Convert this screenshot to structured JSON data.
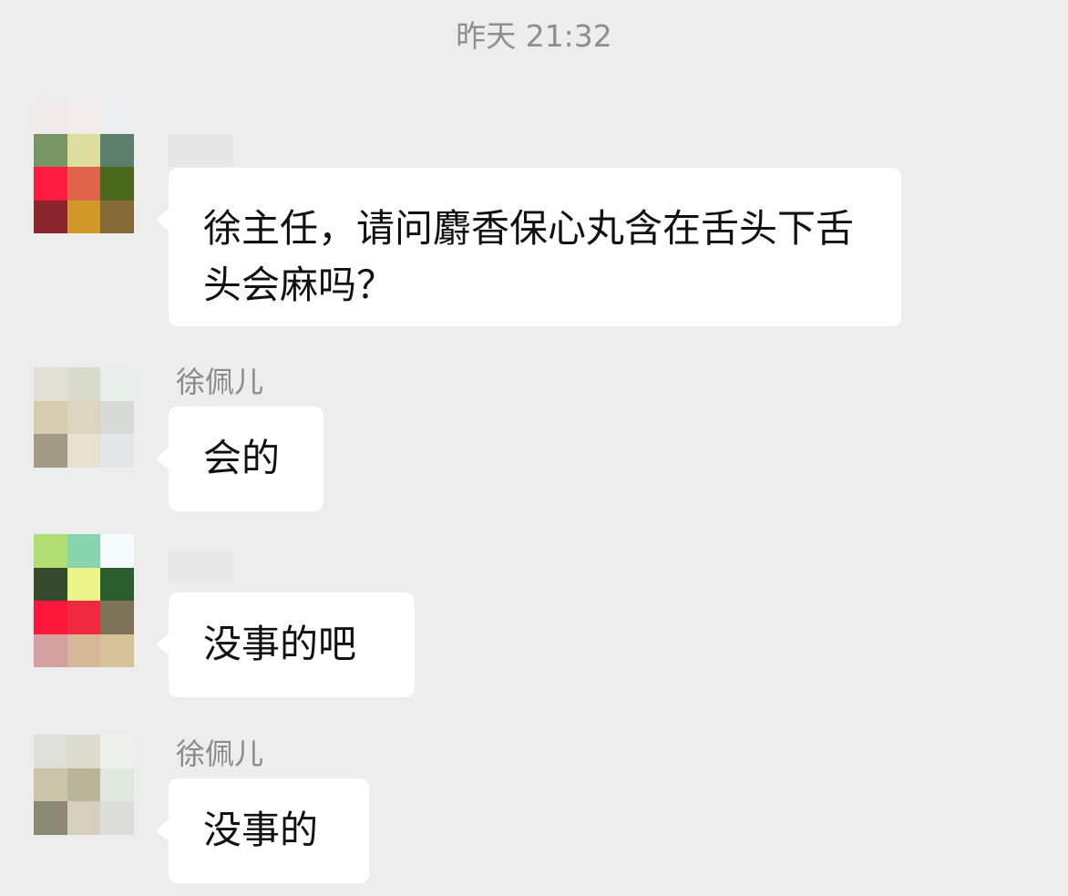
{
  "chat": {
    "timestamp": "昨天 21:32",
    "messages": [
      {
        "sender": "",
        "text": "徐主任，请问麝香保心丸含在舌头下舌头会麻吗？",
        "avatar_colors": [
          "#f1eaea",
          "#f2ecea",
          "#eceef0",
          "#789663",
          "#dede9e",
          "#5c7e6c",
          "#ff1a3f",
          "#e0644c",
          "#4a681c",
          "#8c252b",
          "#d19a28",
          "#856a37"
        ]
      },
      {
        "sender": "徐佩儿",
        "text": "会的",
        "avatar_colors": [
          "#dfdfd3",
          "#d9dbcd",
          "#e8efe9",
          "#d8ccb0",
          "#ded5c0",
          "#d7dad6",
          "#a39b86",
          "#e8e1d0",
          "#e3e6e6",
          "#ededed",
          "#ededed",
          "#ededed"
        ]
      },
      {
        "sender": "",
        "text": "没事的吧",
        "avatar_colors": [
          "#b1df72",
          "#87d5ae",
          "#f5fbfd",
          "#364a2e",
          "#ecf387",
          "#2b5c2e",
          "#ff163b",
          "#ef2a3d",
          "#7d7456",
          "#d4a1a1",
          "#d6b898",
          "#d6c199"
        ]
      },
      {
        "sender": "徐佩儿",
        "text": "没事的",
        "avatar_colors": [
          "#dfdfd9",
          "#dcdccc",
          "#eef0ee",
          "#cbc4a9",
          "#bab599",
          "#e0e7df",
          "#8a8a74",
          "#d6cfbd",
          "#dcdcda",
          "#ededed",
          "#ededed",
          "#ededed"
        ]
      }
    ]
  }
}
